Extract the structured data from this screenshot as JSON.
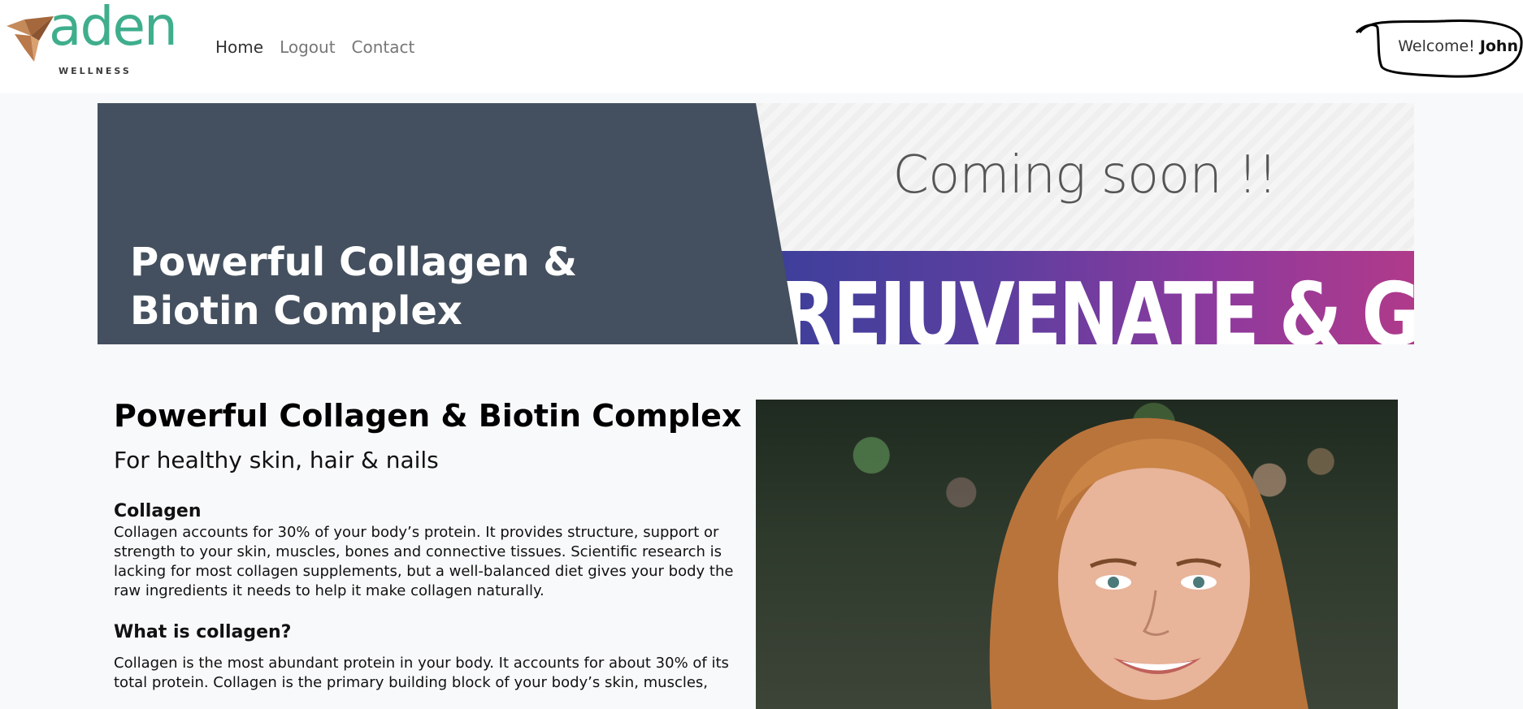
{
  "brand": {
    "name": "aden",
    "tagline": "WELLNESS"
  },
  "nav": {
    "home": "Home",
    "logout": "Logout",
    "contact": "Contact"
  },
  "welcome": {
    "prefix": "Welcome!",
    "user": "John"
  },
  "banner": {
    "title": "Powerful Collagen & Biotin Complex",
    "coming_soon": "Coming soon !!",
    "promo_text": "REJUVENATE & GLOW"
  },
  "content": {
    "title": "Powerful Collagen & Biotin Complex",
    "subtitle": "For healthy skin, hair & nails",
    "section1_heading": "Collagen",
    "section1_text": "Collagen accounts for 30% of your body’s protein. It provides structure, support or strength to your skin, muscles, bones and connective tissues. Scientific research is lacking for most collagen supplements, but a well-balanced diet gives your body the raw ingredients it needs to help it make collagen naturally.",
    "section2_heading": "What is collagen?",
    "section2_text": "Collagen is the most abundant protein in your body. It accounts for about 30% of its total protein. Collagen is the primary building block of your body’s skin, muscles,"
  },
  "colors": {
    "brand_green": "#3fae8c",
    "banner_dark": "#44505f",
    "page_bg": "#f8f9fa"
  }
}
